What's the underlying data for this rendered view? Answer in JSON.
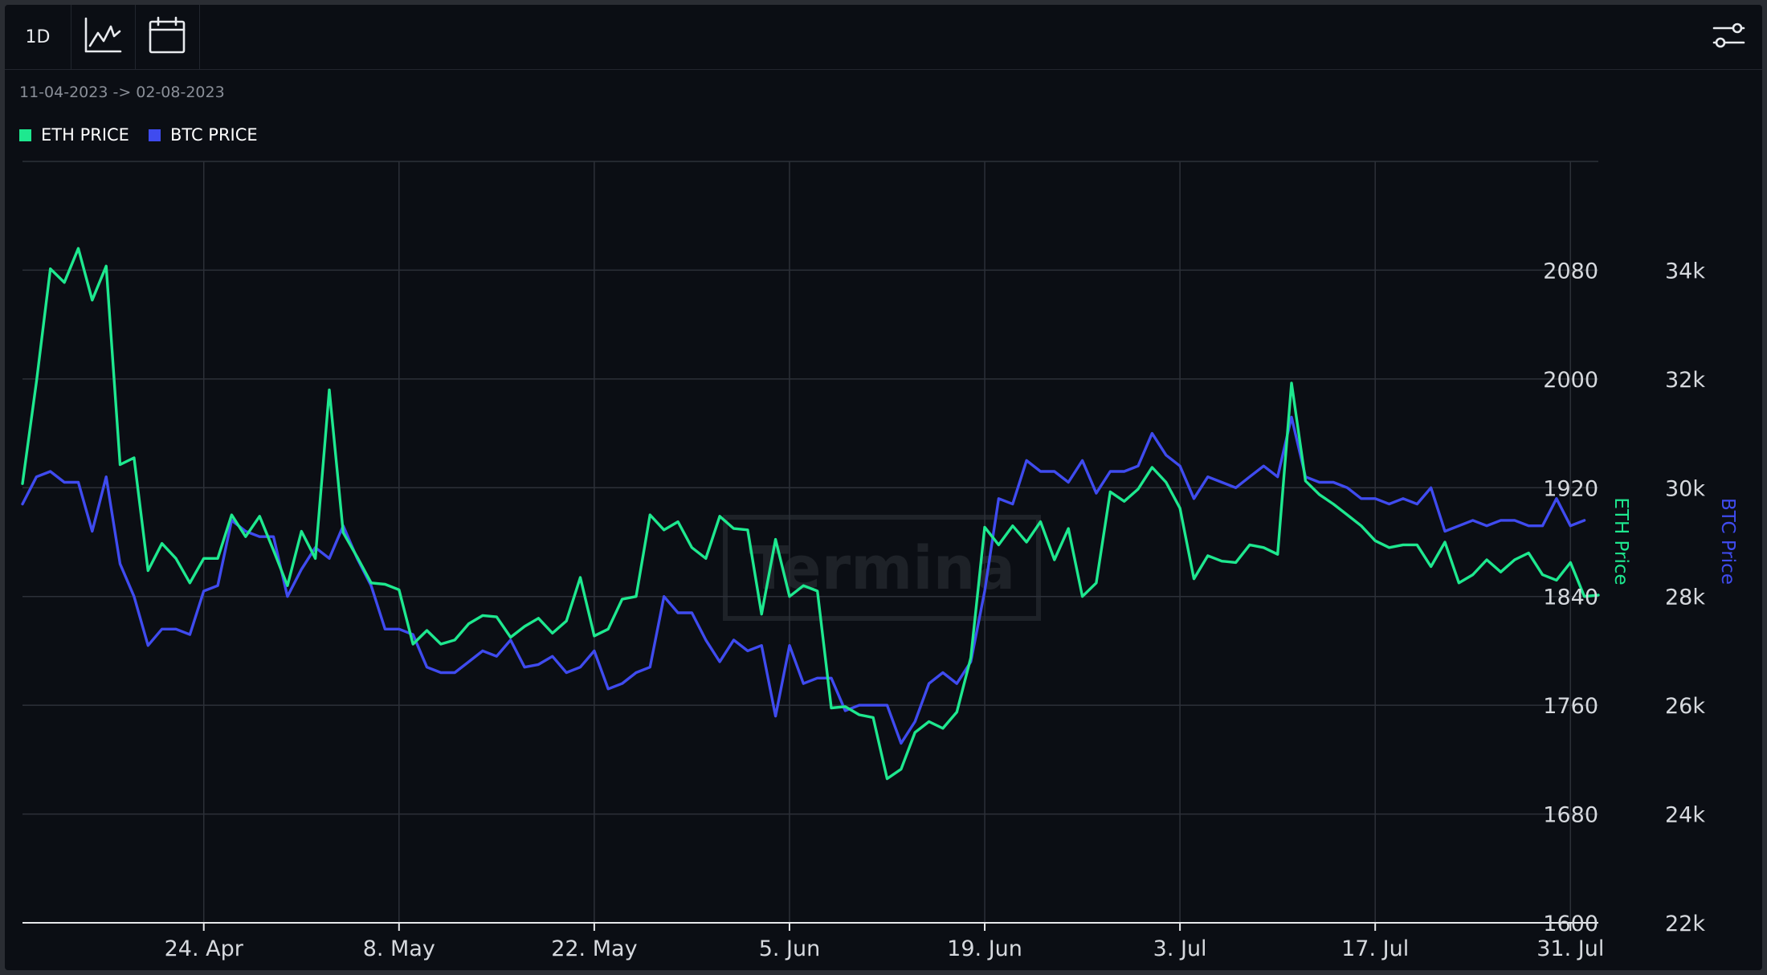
{
  "toolbar": {
    "interval_label": "1D",
    "chart_icon": "line-chart-icon",
    "calendar_icon": "calendar-icon",
    "settings_icon": "sliders-icon"
  },
  "date_range": "11-04-2023 -> 02-08-2023",
  "legend": [
    {
      "label": "ETH PRICE",
      "color": "#1ee88f"
    },
    {
      "label": "BTC PRICE",
      "color": "#3f4bef"
    }
  ],
  "watermark": "Termina",
  "chart_data": {
    "type": "line",
    "x_labels": [
      "24. Apr",
      "8. May",
      "22. May",
      "5. Jun",
      "19. Jun",
      "3. Jul",
      "17. Jul",
      "31. Jul"
    ],
    "x_label_days": [
      13,
      27,
      41,
      55,
      69,
      83,
      97,
      111
    ],
    "x_start": "11-04-2023",
    "x_end": "02-08-2023",
    "xlim": [
      0,
      113
    ],
    "series": [
      {
        "name": "ETH PRICE",
        "axis_title": "ETH Price",
        "color": "#1ee88f",
        "axis": "left",
        "ylim": [
          1600,
          2160
        ],
        "ticks": [
          1600,
          1680,
          1760,
          1840,
          1920,
          2000,
          2080
        ],
        "tick_labels": [
          "1600",
          "1680",
          "1760",
          "1840",
          "1920",
          "2000",
          "2080"
        ],
        "values": [
          1923,
          1998,
          2081,
          2071,
          2096,
          2058,
          2083,
          1937,
          1942,
          1859,
          1879,
          1868,
          1850,
          1868,
          1868,
          1900,
          1884,
          1899,
          1874,
          1848,
          1888,
          1868,
          1992,
          1887,
          1869,
          1850,
          1849,
          1845,
          1805,
          1815,
          1805,
          1808,
          1820,
          1826,
          1825,
          1810,
          1818,
          1824,
          1813,
          1822,
          1854,
          1811,
          1816,
          1838,
          1840,
          1900,
          1889,
          1895,
          1876,
          1868,
          1899,
          1890,
          1889,
          1827,
          1882,
          1840,
          1848,
          1844,
          1758,
          1759,
          1753,
          1751,
          1706,
          1713,
          1740,
          1748,
          1743,
          1755,
          1795,
          1891,
          1878,
          1892,
          1880,
          1895,
          1867,
          1890,
          1840,
          1850,
          1917,
          1910,
          1919,
          1935,
          1924,
          1905,
          1853,
          1870,
          1866,
          1865,
          1878,
          1876,
          1871,
          1997,
          1925,
          1915,
          1908,
          1900,
          1892,
          1881,
          1876,
          1878,
          1878,
          1862,
          1880,
          1850,
          1856,
          1867,
          1858,
          1867,
          1872,
          1856,
          1852,
          1865,
          1840,
          1841
        ]
      },
      {
        "name": "BTC PRICE",
        "axis_title": "BTC Price",
        "color": "#3f4bef",
        "axis": "right",
        "ylim": [
          22000,
          36000
        ],
        "ticks": [
          22000,
          24000,
          26000,
          28000,
          30000,
          32000,
          34000
        ],
        "tick_labels": [
          "22k",
          "24k",
          "26k",
          "28k",
          "30k",
          "32k",
          "34k"
        ],
        "values": [
          29700,
          30200,
          30300,
          30100,
          30100,
          29200,
          30200,
          28600,
          28000,
          27100,
          27400,
          27400,
          27300,
          28100,
          28200,
          29400,
          29200,
          29100,
          29100,
          28000,
          28500,
          28900,
          28700,
          29300,
          28700,
          28200,
          27400,
          27400,
          27300,
          26700,
          26600,
          26600,
          26800,
          27000,
          26900,
          27200,
          26700,
          26750,
          26900,
          26600,
          26700,
          27000,
          26300,
          26400,
          26600,
          26700,
          28000,
          27700,
          27700,
          27200,
          26800,
          27200,
          27000,
          27100,
          25800,
          27100,
          26400,
          26500,
          26500,
          25900,
          26000,
          26000,
          26000,
          25300,
          25700,
          26400,
          26600,
          26400,
          26800,
          28100,
          29800,
          29700,
          30500,
          30300,
          30300,
          30100,
          30500,
          29900,
          30300,
          30300,
          30400,
          31000,
          30600,
          30400,
          29800,
          30200,
          30100,
          30000,
          30200,
          30400,
          30200,
          31300,
          30200,
          30100,
          30100,
          30000,
          29800,
          29800,
          29700,
          29800,
          29700,
          30000,
          29200,
          29300,
          29400,
          29300,
          29400,
          29400,
          29300,
          29300,
          29800,
          29300,
          29400
        ]
      }
    ]
  }
}
